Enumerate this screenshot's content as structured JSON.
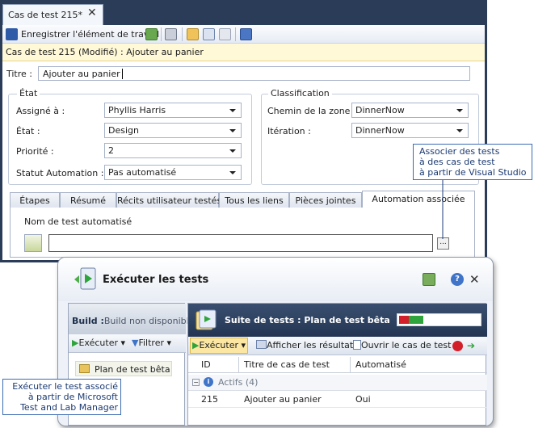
{
  "work_item": {
    "tab_title": "Cas de test 215*",
    "toolbar": {
      "save_label": "Enregistrer l'élément de travail"
    },
    "info_bar": "Cas de test 215 (Modifié) : Ajouter au panier",
    "title_label": "Titre :",
    "title_value": "Ajouter au panier",
    "state_group": {
      "legend": "État",
      "fields": [
        {
          "label": "Assigné à :",
          "value": "Phyllis Harris"
        },
        {
          "label": "État :",
          "value": "Design"
        },
        {
          "label": "Priorité :",
          "value": "2"
        },
        {
          "label": "Statut Automation :",
          "value": "Pas automatisé"
        }
      ]
    },
    "classification_group": {
      "legend": "Classification",
      "fields": [
        {
          "label": "Chemin de la zone :",
          "value": "DinnerNow"
        },
        {
          "label": "Itération :",
          "value": "DinnerNow"
        }
      ]
    },
    "tabs": [
      {
        "label": "Étapes"
      },
      {
        "label": "Résumé"
      },
      {
        "label": "Récits utilisateur testés"
      },
      {
        "label": "Tous les liens"
      },
      {
        "label": "Pièces jointes"
      },
      {
        "label": "Automation associée",
        "active": true
      }
    ],
    "automation_panel": {
      "name_label": "Nom de test automatisé",
      "name_value": "",
      "browse_label": "..."
    }
  },
  "callouts": {
    "vs": [
      "Associer des tests",
      "à des cas de test",
      "à partir de Visual Studio"
    ],
    "mtm": [
      "Exécuter le test associé",
      "à partir de Microsoft",
      "Test and Lab Manager"
    ]
  },
  "test_manager": {
    "title": "Exécuter les tests",
    "build_label_bold": "Build :",
    "build_label_rest": "Build non disponible",
    "left_toolbar": {
      "run": "Exécuter",
      "filter": "Filtrer"
    },
    "plan_item": "Plan de test bêta",
    "suite_title": "Suite de tests : Plan de test bêta",
    "progress": {
      "failed_fraction": 0.12,
      "passed_fraction": 0.18,
      "failed_color": "#d21f2a",
      "passed_color": "#2fa43c"
    },
    "right_toolbar": {
      "run": "Exécuter",
      "view_results": "Afficher les résultats",
      "open_case": "Ouvrir le cas de test"
    },
    "grid": {
      "columns": [
        "ID",
        "Titre de cas de test",
        "Automatisé"
      ],
      "group": "Actifs (4)",
      "rows": [
        {
          "id": "215",
          "title": "Ajouter au panier",
          "automated": "Oui"
        }
      ]
    }
  }
}
